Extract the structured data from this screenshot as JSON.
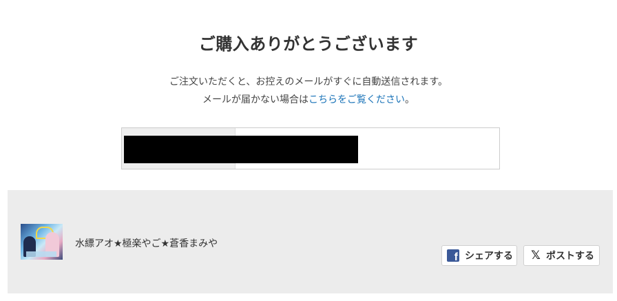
{
  "header": {
    "title": "ご購入ありがとうございます"
  },
  "message": {
    "line1": "ご注文いただくと、お控えのメールがすぐに自動送信されます。",
    "line2_prefix": "メールが届かない場合は",
    "line2_link": "こちらをご覧ください",
    "line2_suffix": "。"
  },
  "order": {
    "redacted": true
  },
  "footer": {
    "item_title": "水縹アオ★極楽やご★蒼香まみや",
    "share_facebook_label": "シェアする",
    "share_x_label": "ポストする",
    "x_glyph": "𝕏"
  },
  "colors": {
    "link": "#1a73b8",
    "facebook": "#3b5998",
    "footer_bg": "#ececec"
  },
  "icons": {
    "facebook": "facebook-icon",
    "x": "x-icon"
  }
}
